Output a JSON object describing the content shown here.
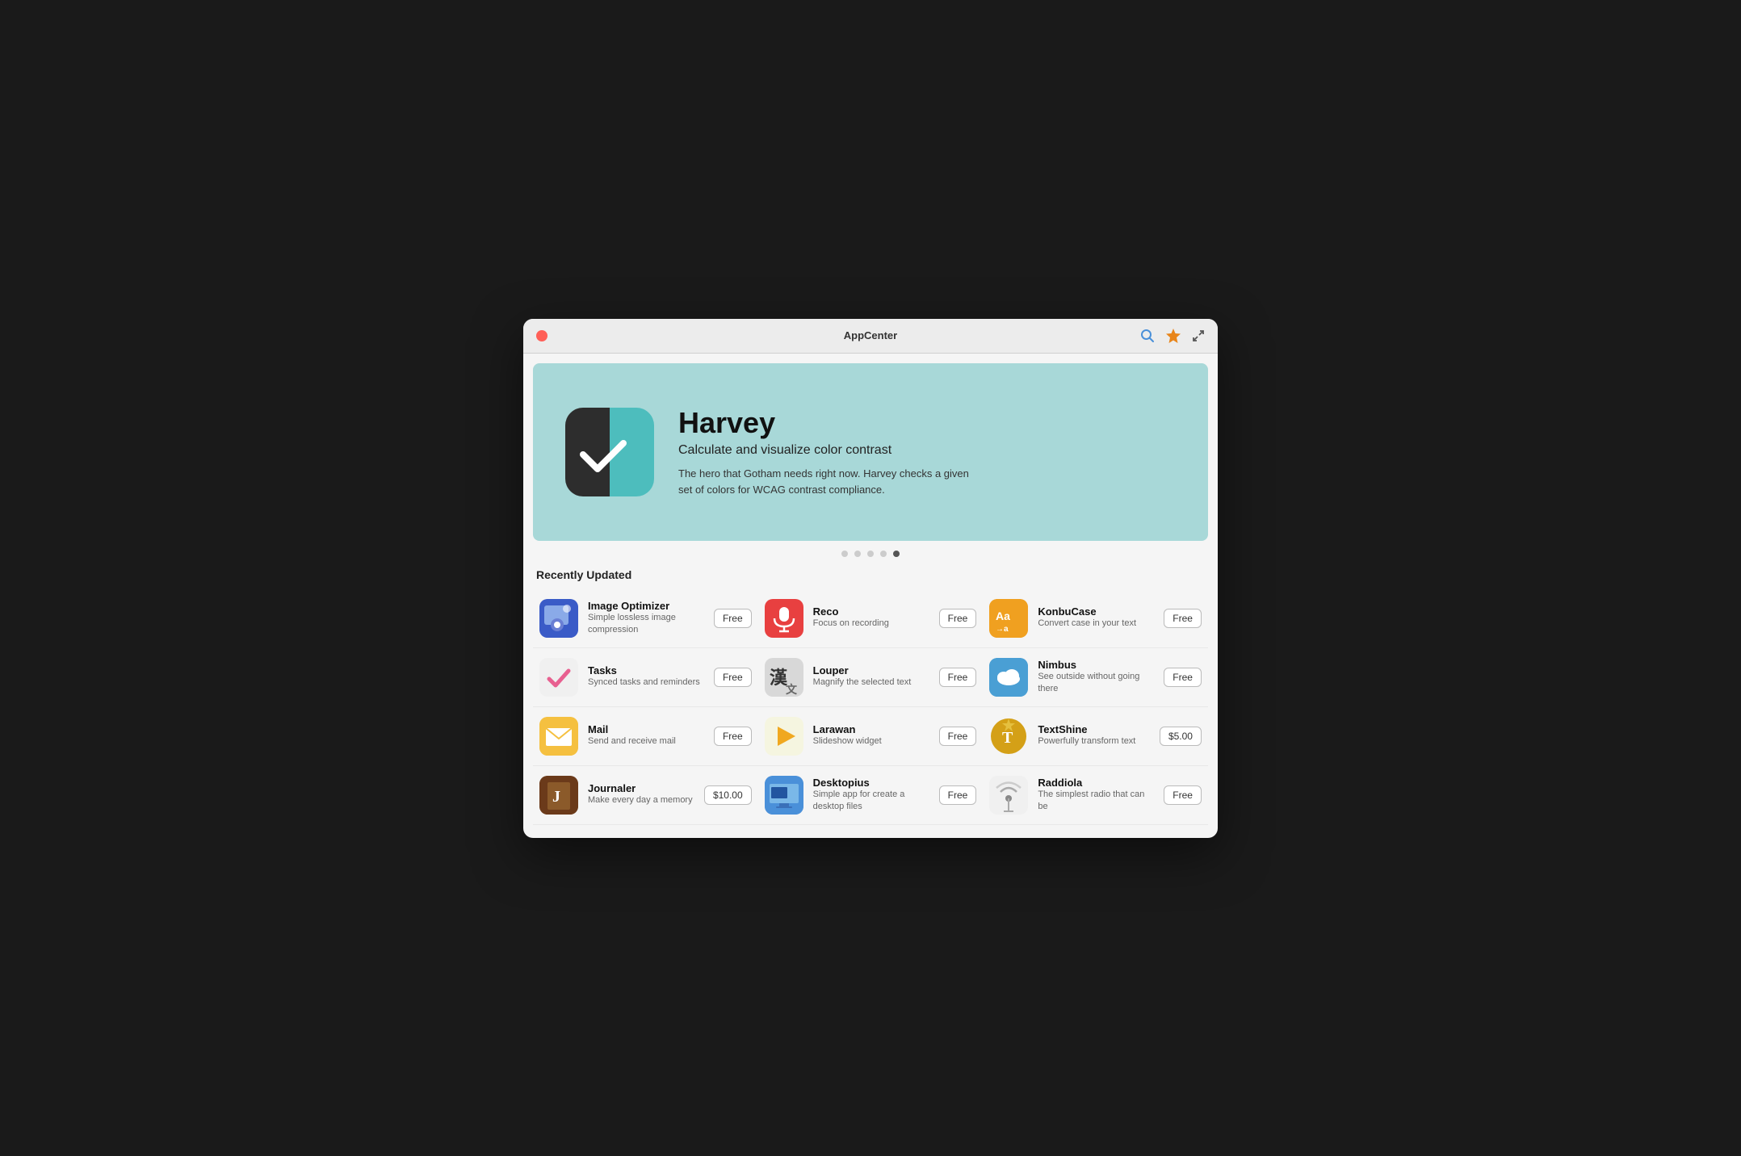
{
  "window": {
    "title": "AppCenter"
  },
  "titlebar": {
    "close_label": "×",
    "search_icon": "🔍",
    "badge_icon": "✦",
    "expand_icon": "⤢"
  },
  "hero": {
    "app_name": "Harvey",
    "subtitle": "Calculate and visualize color contrast",
    "description": "The hero that Gotham needs right now. Harvey checks a given set of colors for WCAG contrast compliance."
  },
  "dots": [
    {
      "active": false
    },
    {
      "active": false
    },
    {
      "active": false
    },
    {
      "active": false
    },
    {
      "active": true
    }
  ],
  "section_title": "Recently Updated",
  "apps": [
    {
      "col": 0,
      "name": "Image Optimizer",
      "desc": "Simple lossless image compression",
      "price": "Free",
      "icon_class": "icon-image-optimizer",
      "icon_symbol": "⚙"
    },
    {
      "col": 1,
      "name": "Reco",
      "desc": "Focus on recording",
      "price": "Free",
      "icon_class": "icon-reco",
      "icon_symbol": "🎙"
    },
    {
      "col": 2,
      "name": "KonbuCase",
      "desc": "Convert case in your text",
      "price": "Free",
      "icon_class": "icon-konbucase",
      "icon_symbol": "Aa"
    },
    {
      "col": 0,
      "name": "Tasks",
      "desc": "Synced tasks and reminders",
      "price": "Free",
      "icon_class": "icon-tasks",
      "icon_symbol": "✓"
    },
    {
      "col": 1,
      "name": "Louper",
      "desc": "Magnify the selected text",
      "price": "Free",
      "icon_class": "icon-louper",
      "icon_symbol": "漢"
    },
    {
      "col": 2,
      "name": "Nimbus",
      "desc": "See outside without going there",
      "price": "Free",
      "icon_class": "icon-nimbus",
      "icon_symbol": "☁"
    },
    {
      "col": 0,
      "name": "Mail",
      "desc": "Send and receive mail",
      "price": "Free",
      "icon_class": "icon-mail",
      "icon_symbol": "✉"
    },
    {
      "col": 1,
      "name": "Larawan",
      "desc": "Slideshow widget",
      "price": "Free",
      "icon_class": "icon-larawan",
      "icon_symbol": "▶"
    },
    {
      "col": 2,
      "name": "TextShine",
      "desc": "Powerfully transform text",
      "price": "$5.00",
      "icon_class": "icon-textshine",
      "icon_symbol": "T"
    },
    {
      "col": 0,
      "name": "Journaler",
      "desc": "Make every day a memory",
      "price": "$10.00",
      "icon_class": "icon-journaler",
      "icon_symbol": "J"
    },
    {
      "col": 1,
      "name": "Desktopius",
      "desc": "Simple app for create a desktop files",
      "price": "Free",
      "icon_class": "icon-desktopius",
      "icon_symbol": "🖥"
    },
    {
      "col": 2,
      "name": "Raddiola",
      "desc": "The simplest radio that can be",
      "price": "Free",
      "icon_class": "icon-raddiola",
      "icon_symbol": "📡"
    }
  ]
}
